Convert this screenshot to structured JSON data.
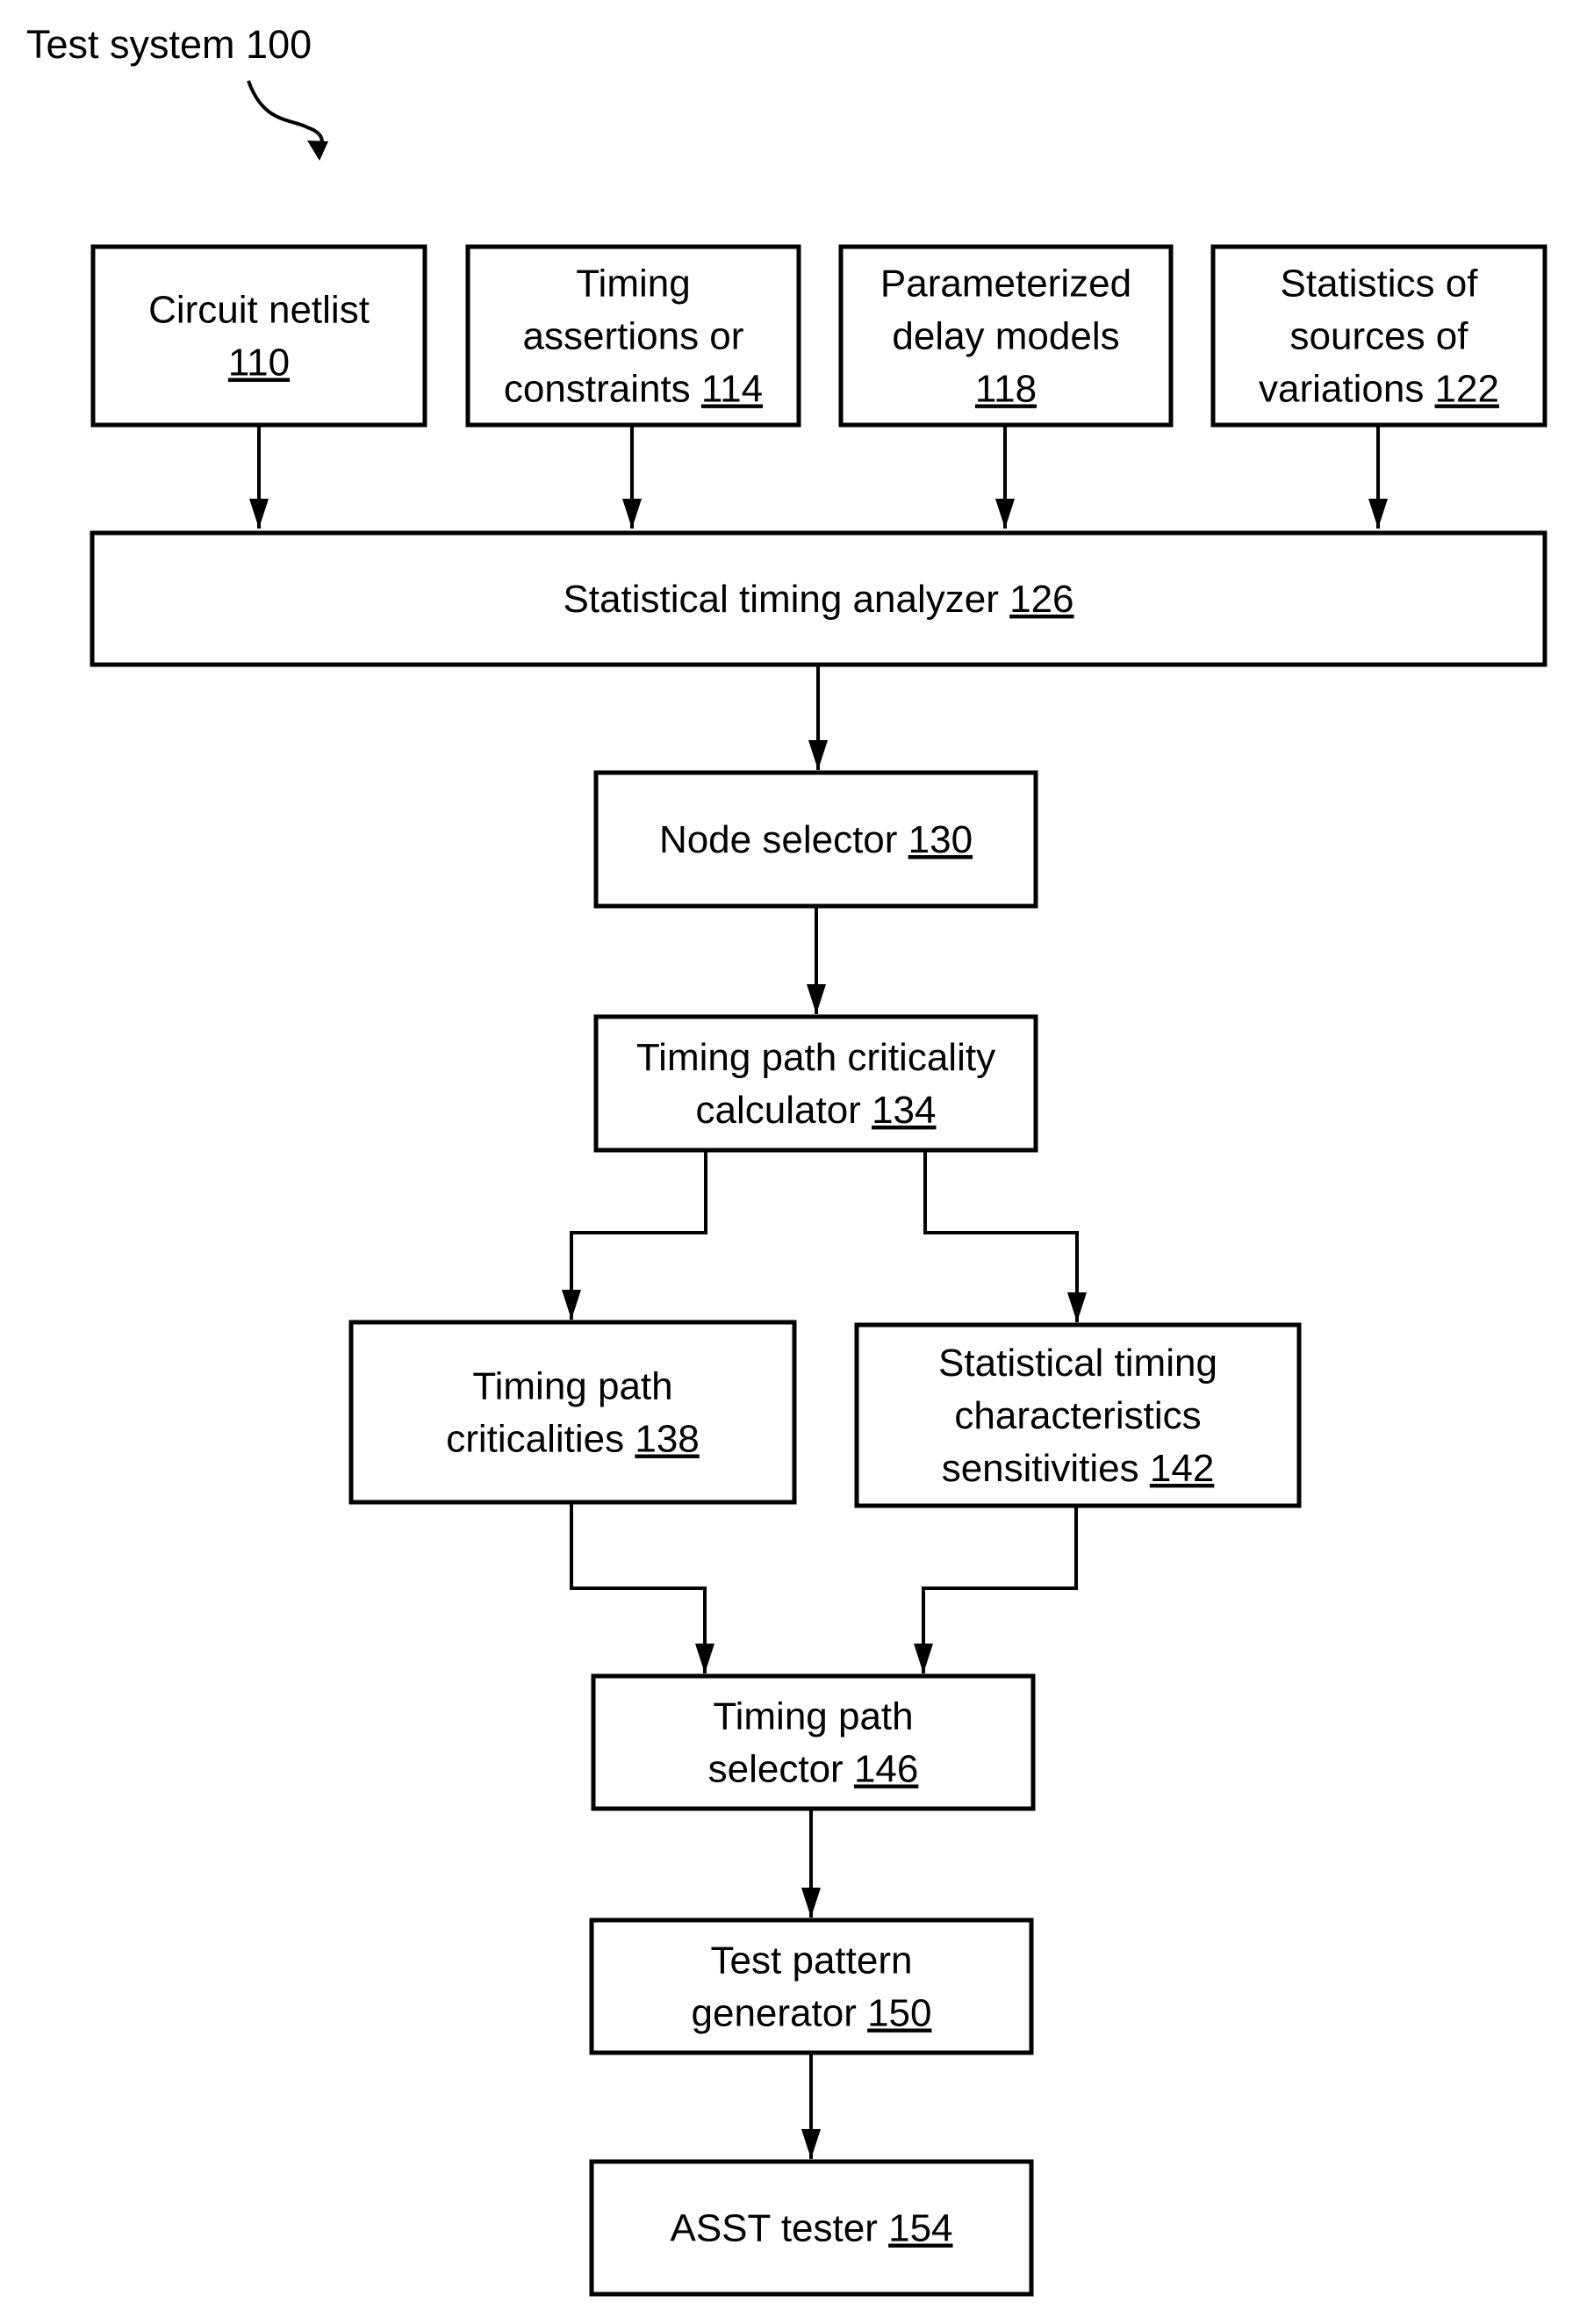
{
  "title": "Test system 100",
  "nodes": {
    "circuit_netlist": {
      "lines": [
        "Circuit netlist"
      ],
      "ref": "110"
    },
    "timing_assertions": {
      "lines": [
        "Timing",
        "assertions or",
        "constraints"
      ],
      "ref": "114"
    },
    "delay_models": {
      "lines": [
        "Parameterized",
        "delay models"
      ],
      "ref": "118"
    },
    "variation_stats": {
      "lines": [
        "Statistics of",
        "sources of",
        "variations"
      ],
      "ref": "122"
    },
    "sta": {
      "lines": [
        "Statistical timing analyzer"
      ],
      "ref": "126"
    },
    "node_selector": {
      "lines": [
        "Node selector"
      ],
      "ref": "130"
    },
    "criticality_calc": {
      "lines": [
        "Timing path criticality",
        "calculator"
      ],
      "ref": "134"
    },
    "criticalities": {
      "lines": [
        "Timing path",
        "criticalities"
      ],
      "ref": "138"
    },
    "sensitivities": {
      "lines": [
        "Statistical timing",
        "characteristics",
        "sensitivities"
      ],
      "ref": "142"
    },
    "path_selector": {
      "lines": [
        "Timing path",
        "selector"
      ],
      "ref": "146"
    },
    "pattern_gen": {
      "lines": [
        "Test pattern",
        "generator"
      ],
      "ref": "150"
    },
    "asst_tester": {
      "lines": [
        "ASST tester"
      ],
      "ref": "154"
    }
  },
  "edges": [
    [
      "circuit_netlist",
      "sta"
    ],
    [
      "timing_assertions",
      "sta"
    ],
    [
      "delay_models",
      "sta"
    ],
    [
      "variation_stats",
      "sta"
    ],
    [
      "sta",
      "node_selector"
    ],
    [
      "node_selector",
      "criticality_calc"
    ],
    [
      "criticality_calc",
      "criticalities"
    ],
    [
      "criticality_calc",
      "sensitivities"
    ],
    [
      "criticalities",
      "path_selector"
    ],
    [
      "sensitivities",
      "path_selector"
    ],
    [
      "path_selector",
      "pattern_gen"
    ],
    [
      "pattern_gen",
      "asst_tester"
    ]
  ]
}
